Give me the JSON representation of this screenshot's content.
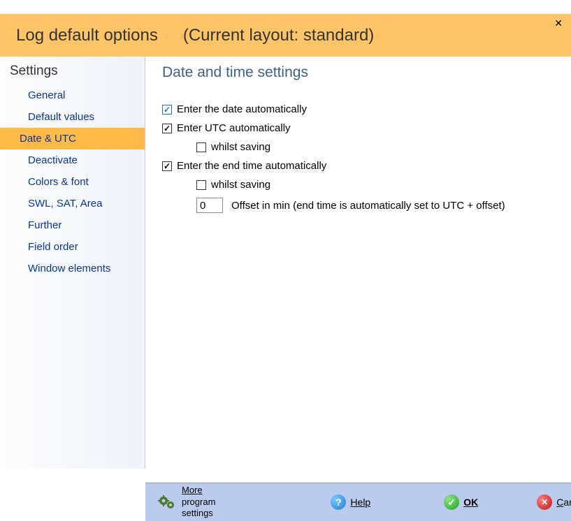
{
  "window": {
    "title": "Log default options",
    "subtitle": "(Current layout: standard)"
  },
  "sidebar": {
    "heading": "Settings",
    "items": [
      {
        "label": "General",
        "selected": false
      },
      {
        "label": "Default values",
        "selected": false
      },
      {
        "label": "Date & UTC",
        "selected": true
      },
      {
        "label": "Deactivate",
        "selected": false
      },
      {
        "label": "Colors & font",
        "selected": false
      },
      {
        "label": "SWL, SAT, Area",
        "selected": false
      },
      {
        "label": "Further",
        "selected": false
      },
      {
        "label": "Field order",
        "selected": false
      },
      {
        "label": "Window elements",
        "selected": false
      }
    ]
  },
  "content": {
    "heading": "Date and time settings",
    "options": {
      "enter_date_auto": {
        "label": "Enter the date automatically",
        "checked": true,
        "accent": "blue"
      },
      "enter_utc_auto": {
        "label": "Enter UTC automatically",
        "checked": true
      },
      "utc_whilst_saving": {
        "label": "whilst saving",
        "checked": false
      },
      "enter_end_auto": {
        "label": "Enter the end time automatically",
        "checked": true
      },
      "end_whilst_saving": {
        "label": "whilst saving",
        "checked": false
      },
      "offset_value": "0",
      "offset_label": "Offset in min (end time is automatically set to UTC + offset)"
    }
  },
  "bottombar": {
    "more_line1": "More",
    "more_line2": "program settings",
    "help": "Help",
    "ok": "OK",
    "cancel": "Cancel"
  }
}
